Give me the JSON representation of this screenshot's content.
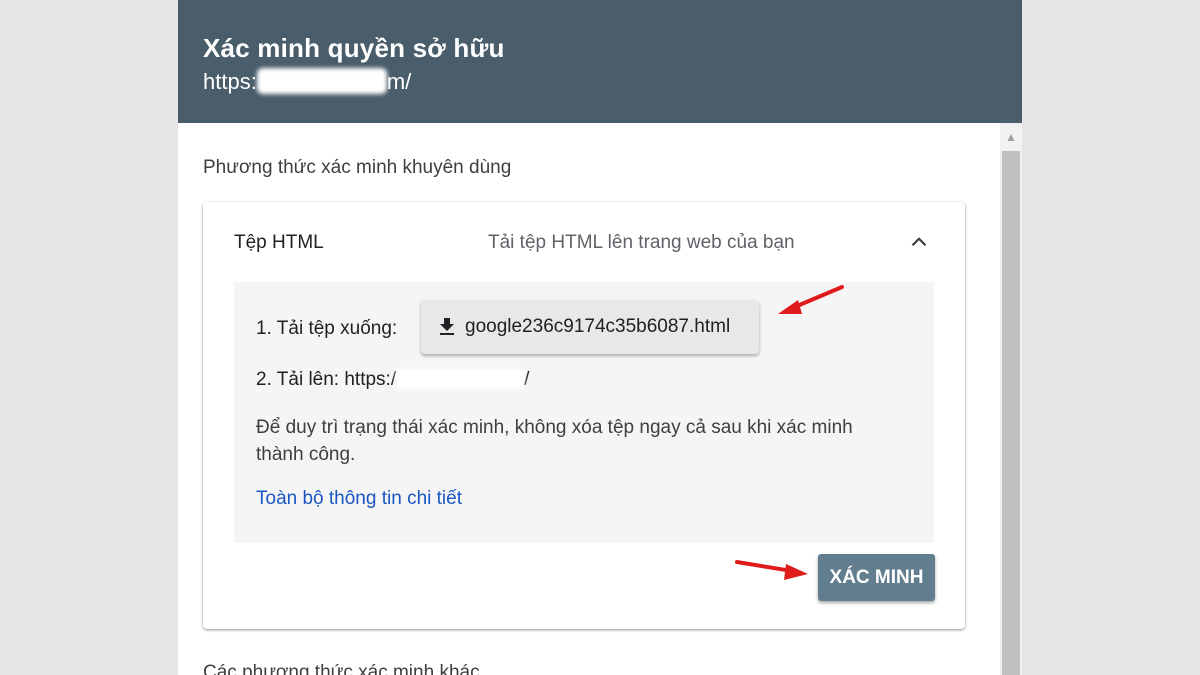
{
  "dialog": {
    "title": "Xác minh quyền sở hữu",
    "url_prefix": "https:",
    "url_suffix": "m/"
  },
  "recommended_label": "Phương thức xác minh khuyên dùng",
  "card": {
    "title": "Tệp HTML",
    "description": "Tải tệp HTML lên trang web của bạn",
    "step1_label": "1. Tải tệp xuống:",
    "download_filename": "google236c9174c35b6087.html",
    "step2_prefix": "2. Tải lên: https:/",
    "step2_suffix": "/",
    "note": "Để duy trì trạng thái xác minh, không xóa tệp ngay cả sau khi xác minh thành công.",
    "details_link": "Toàn bộ thông tin chi tiết",
    "verify_button": "XÁC MINH"
  },
  "other_methods_label": "Các phương thức xác minh khác",
  "colors": {
    "header_bg": "#4a5d6b",
    "verify_bg": "#627d8e",
    "link": "#1a56c4",
    "annotation_arrow": "#e01b1b"
  },
  "icons": {
    "download": "download-icon",
    "collapse": "chevron-up-icon",
    "scroll_up": "scroll-up-arrow"
  }
}
